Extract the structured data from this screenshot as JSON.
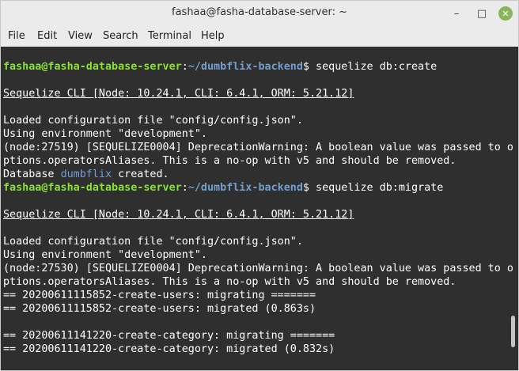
{
  "window": {
    "title": "fashaa@fasha-database-server: ~",
    "minimize_glyph": "–",
    "maximize_glyph": "□",
    "close_glyph": "✕",
    "close_color": "#8ab55c"
  },
  "menu": [
    "File",
    "Edit",
    "View",
    "Search",
    "Terminal",
    "Help"
  ],
  "terminal": {
    "background": "#2f2f2f",
    "prompt_user": "fashaa@fasha-database-server",
    "prompt_sep": ":",
    "prompt_path": "~/dumbflix-backend",
    "prompt_dollar": "$ ",
    "cmd1": "sequelize db:create",
    "cli_banner": "Sequelize CLI [Node: 10.24.1, CLI: 6.4.1, ORM: 5.21.12]",
    "loaded_config": "Loaded configuration file \"config/config.json\".",
    "using_env": "Using environment \"development\".",
    "deprecation1_a": "(node:27519) [SEQUELIZE0004] DeprecationWarning: A boolean value was passed to o",
    "deprecation_b": "ptions.operatorsAliases. This is a no-op with v5 and should be removed.",
    "db_word": "Database ",
    "db_name": "dumbflix",
    "db_created": " created.",
    "cmd2": "sequelize db:migrate",
    "deprecation2_a": "(node:27530) [SEQUELIZE0004] DeprecationWarning: A boolean value was passed to o",
    "mig1_migrating": "== 20200611115852-create-users: migrating =======",
    "mig1_migrated": "== 20200611115852-create-users: migrated (0.863s)",
    "mig2_migrating": "== 20200611141220-create-category: migrating =======",
    "mig2_migrated": "== 20200611141220-create-category: migrated (0.832s)"
  }
}
